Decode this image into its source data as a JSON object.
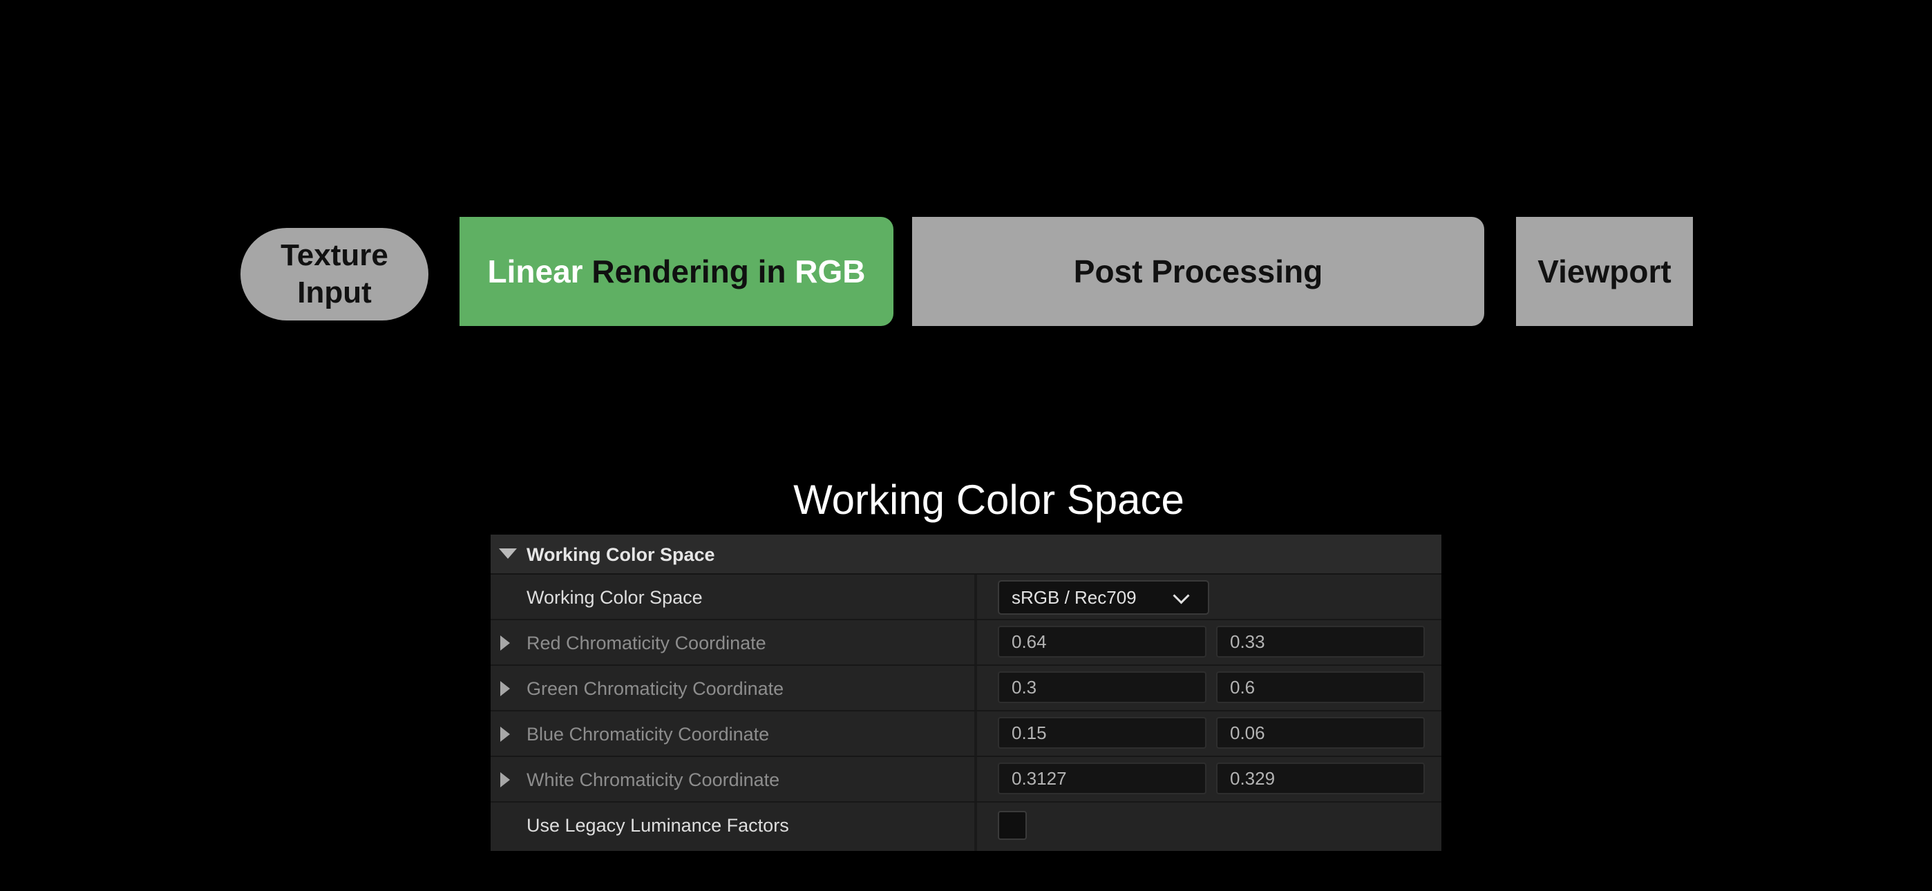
{
  "pipeline": {
    "texture_input": {
      "line1": "Texture",
      "line2": "Input"
    },
    "linear_rendering": {
      "part1": "Linear",
      "part2": "Rendering in",
      "part3": "RGB"
    },
    "post_processing": "Post Processing",
    "viewport": "Viewport"
  },
  "colors": {
    "active_stage": "#5fb063",
    "inactive_stage": "#a6a6a6"
  },
  "section_title": "Working Color Space",
  "panel": {
    "header": "Working Color Space",
    "working_color_space": {
      "label": "Working Color Space",
      "value": "sRGB / Rec709"
    },
    "rows": [
      {
        "label": "Red Chromaticity Coordinate",
        "x": "0.64",
        "y": "0.33"
      },
      {
        "label": "Green Chromaticity Coordinate",
        "x": "0.3",
        "y": "0.6"
      },
      {
        "label": "Blue Chromaticity Coordinate",
        "x": "0.15",
        "y": "0.06"
      },
      {
        "label": "White Chromaticity Coordinate",
        "x": "0.3127",
        "y": "0.329"
      }
    ],
    "legacy": {
      "label": "Use Legacy Luminance Factors",
      "checked": false
    }
  }
}
